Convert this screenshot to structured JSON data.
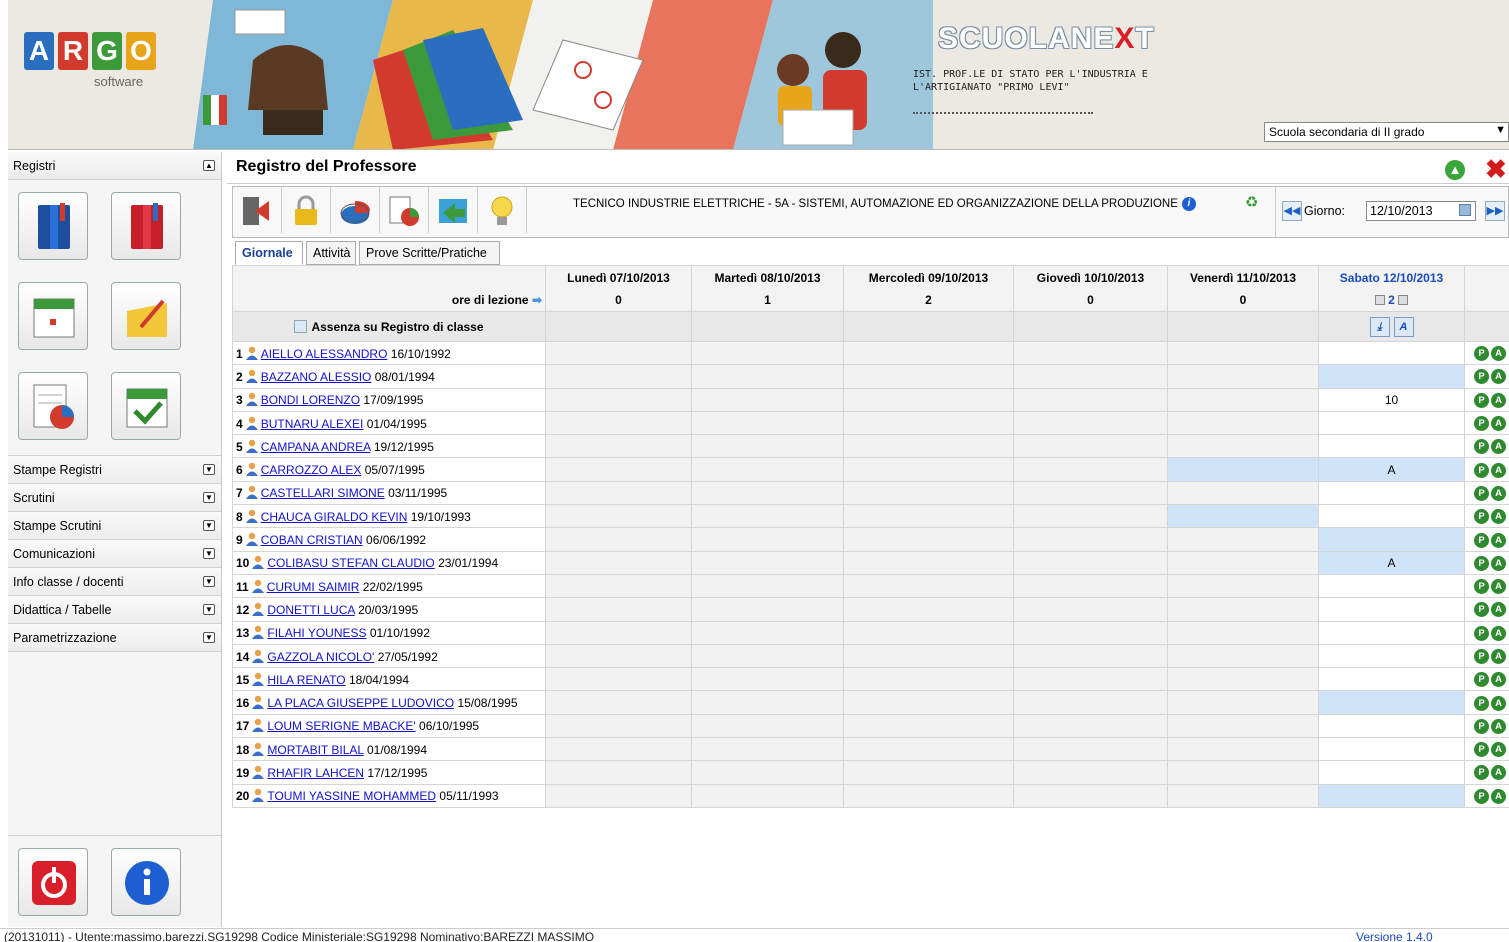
{
  "header": {
    "logo_letters": [
      "A",
      "R",
      "G",
      "O"
    ],
    "logo_colors": [
      "#2a6fbf",
      "#d23a2e",
      "#3d9a3a",
      "#e8a51a"
    ],
    "logo_sub": "software",
    "brand_main": "SCUOLANE",
    "brand_x": "X",
    "brand_end": "T",
    "school_name": "IST. PROF.LE DI STATO PER L'INDUSTRIA E L'ARTIGIANATO \"PRIMO LEVI\"",
    "school_level": "Scuola secondaria di II grado"
  },
  "sidebar": {
    "sections": [
      {
        "label": "Registri",
        "expanded": true
      },
      {
        "label": "Stampe Registri"
      },
      {
        "label": "Scrutini"
      },
      {
        "label": "Stampe Scrutini"
      },
      {
        "label": "Comunicazioni"
      },
      {
        "label": "Info classe / docenti"
      },
      {
        "label": "Didattica / Tabelle"
      },
      {
        "label": "Parametrizzazione"
      }
    ]
  },
  "main": {
    "title": "Registro del Professore",
    "course": "TECNICO INDUSTRIE ELETTRICHE - 5A - SISTEMI, AUTOMAZIONE ED ORGANIZZAZIONE DELLA PRODUZIONE",
    "date_label": "Giorno:",
    "date_value": "12/10/2013",
    "tabs": [
      "Giornale",
      "Attività",
      "Prove Scritte/Pratiche"
    ],
    "hours_label": "ore di lezione",
    "absence_label": "Assenza su Registro di classe",
    "days": [
      {
        "label": "Lunedì 07/10/2013",
        "hours": "0"
      },
      {
        "label": "Martedì 08/10/2013",
        "hours": "1"
      },
      {
        "label": "Mercoledì 09/10/2013",
        "hours": "2"
      },
      {
        "label": "Giovedì 10/10/2013",
        "hours": "0"
      },
      {
        "label": "Venerdì 11/10/2013",
        "hours": "0"
      },
      {
        "label": "Sabato 12/10/2013",
        "hours": "2"
      }
    ],
    "presence_letters": [
      "P",
      "A"
    ],
    "students": [
      {
        "n": "1",
        "name": "AIELLO ALESSANDRO",
        "dob": "16/10/1992",
        "fri": "",
        "sat": "",
        "fri_hl": false,
        "sat_hl": false
      },
      {
        "n": "2",
        "name": "BAZZANO ALESSIO",
        "dob": "08/01/1994",
        "fri": "",
        "sat": "",
        "fri_hl": false,
        "sat_hl": true
      },
      {
        "n": "3",
        "name": "BONDI LORENZO",
        "dob": "17/09/1995",
        "fri": "",
        "sat": "10",
        "fri_hl": false,
        "sat_hl": false
      },
      {
        "n": "4",
        "name": "BUTNARU ALEXEI",
        "dob": "01/04/1995",
        "fri": "",
        "sat": "",
        "fri_hl": false,
        "sat_hl": false
      },
      {
        "n": "5",
        "name": "CAMPANA ANDREA",
        "dob": "19/12/1995",
        "fri": "",
        "sat": "",
        "fri_hl": false,
        "sat_hl": false
      },
      {
        "n": "6",
        "name": "CARROZZO ALEX",
        "dob": "05/07/1995",
        "fri": "",
        "sat": "A",
        "fri_hl": true,
        "sat_hl": true
      },
      {
        "n": "7",
        "name": "CASTELLARI SIMONE",
        "dob": "03/11/1995",
        "fri": "",
        "sat": "",
        "fri_hl": false,
        "sat_hl": false
      },
      {
        "n": "8",
        "name": "CHAUCA GIRALDO KEVIN",
        "dob": "19/10/1993",
        "fri": "",
        "sat": "",
        "fri_hl": true,
        "sat_hl": false
      },
      {
        "n": "9",
        "name": "COBAN CRISTIAN",
        "dob": "06/06/1992",
        "fri": "",
        "sat": "",
        "fri_hl": false,
        "sat_hl": true
      },
      {
        "n": "10",
        "name": "COLIBASU STEFAN CLAUDIO",
        "dob": "23/01/1994",
        "fri": "",
        "sat": "A",
        "fri_hl": false,
        "sat_hl": true
      },
      {
        "n": "11",
        "name": "CURUMI SAIMIR",
        "dob": "22/02/1995",
        "fri": "",
        "sat": "",
        "fri_hl": false,
        "sat_hl": false
      },
      {
        "n": "12",
        "name": "DONETTI LUCA",
        "dob": "20/03/1995",
        "fri": "",
        "sat": "",
        "fri_hl": false,
        "sat_hl": false
      },
      {
        "n": "13",
        "name": "FILAHI YOUNESS",
        "dob": "01/10/1992",
        "fri": "",
        "sat": "",
        "fri_hl": false,
        "sat_hl": false
      },
      {
        "n": "14",
        "name": "GAZZOLA NICOLO'",
        "dob": "27/05/1992",
        "fri": "",
        "sat": "",
        "fri_hl": false,
        "sat_hl": false
      },
      {
        "n": "15",
        "name": "HILA RENATO",
        "dob": "18/04/1994",
        "fri": "",
        "sat": "",
        "fri_hl": false,
        "sat_hl": false
      },
      {
        "n": "16",
        "name": "LA PLACA GIUSEPPE LUDOVICO",
        "dob": "15/08/1995",
        "fri": "",
        "sat": "",
        "fri_hl": false,
        "sat_hl": true,
        "tall": true
      },
      {
        "n": "17",
        "name": "LOUM SERIGNE MBACKE'",
        "dob": "06/10/1995",
        "fri": "",
        "sat": "",
        "fri_hl": false,
        "sat_hl": false
      },
      {
        "n": "18",
        "name": "MORTABIT BILAL",
        "dob": "01/08/1994",
        "fri": "",
        "sat": "",
        "fri_hl": false,
        "sat_hl": false
      },
      {
        "n": "19",
        "name": "RHAFIR LAHCEN",
        "dob": "17/12/1995",
        "fri": "",
        "sat": "",
        "fri_hl": false,
        "sat_hl": false
      },
      {
        "n": "20",
        "name": "TOUMI YASSINE MOHAMMED",
        "dob": "05/11/1993",
        "fri": "",
        "sat": "",
        "fri_hl": false,
        "sat_hl": true
      }
    ]
  },
  "footer": {
    "left": "(20131011) - Utente:massimo.barezzi.SG19298 Codice Ministeriale:SG19298 Nominativo:BAREZZI MASSIMO",
    "right": "Versione 1.4.0"
  }
}
